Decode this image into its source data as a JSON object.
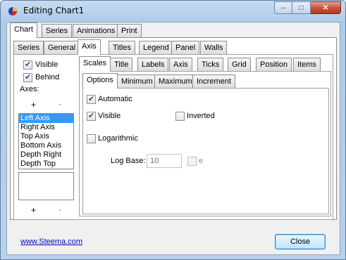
{
  "window": {
    "title": "Editing Chart1"
  },
  "caption_buttons": {
    "minimize": "–",
    "maximize": "□",
    "close": "✕"
  },
  "top_tabs": [
    "Chart",
    "Series",
    "Animations",
    "Print"
  ],
  "chart_tabs": [
    "Series",
    "General",
    "Axis",
    "Titles",
    "Legend",
    "Panel",
    "Walls"
  ],
  "left_panel": {
    "visible_label": "Visible",
    "behind_label": "Behind",
    "axes_label": "Axes:",
    "add_label": "+",
    "remove_label": "-",
    "axes": [
      "Left Axis",
      "Right Axis",
      "Top Axis",
      "Bottom Axis",
      "Depth Right",
      "Depth Top"
    ],
    "selected_axis": "Left Axis"
  },
  "axis_tabs": [
    "Scales",
    "Title",
    "Labels",
    "Axis",
    "Ticks",
    "Grid",
    "Position",
    "Items"
  ],
  "scales_tabs": [
    "Options",
    "Minimum",
    "Maximum",
    "Increment"
  ],
  "options": {
    "automatic_label": "Automatic",
    "visible_label": "Visible",
    "inverted_label": "Inverted",
    "logarithmic_label": "Logarithmic",
    "logbase_label": "Log Base:",
    "logbase_value": "10",
    "e_label": "e",
    "automatic_checked": true,
    "visible_checked": true,
    "inverted_checked": false,
    "logarithmic_checked": false,
    "e_checked": false
  },
  "footer": {
    "link": "www.Steema.com",
    "close_label": "Close"
  }
}
